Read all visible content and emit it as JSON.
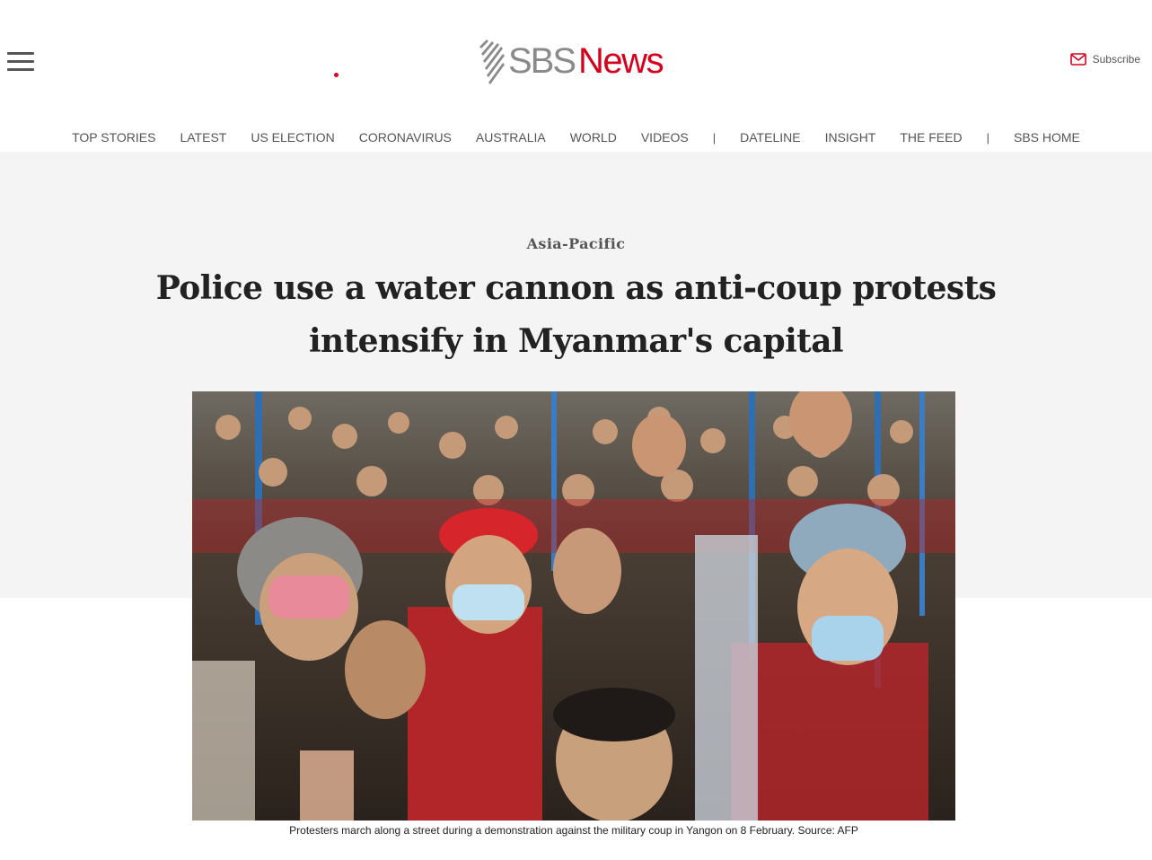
{
  "header": {
    "logo_primary": "SBS",
    "logo_secondary": "News",
    "subscribe_label": "Subscribe",
    "brand_red": "#d6001c",
    "brand_grey": "#8a8a8a"
  },
  "nav": {
    "items": [
      {
        "label": "TOP STORIES"
      },
      {
        "label": "LATEST"
      },
      {
        "label": "US ELECTION"
      },
      {
        "label": "CORONAVIRUS"
      },
      {
        "label": "AUSTRALIA"
      },
      {
        "label": "WORLD"
      },
      {
        "label": "VIDEOS"
      },
      {
        "separator": "|"
      },
      {
        "label": "DATELINE"
      },
      {
        "label": "INSIGHT"
      },
      {
        "label": "THE FEED"
      },
      {
        "separator": "|"
      },
      {
        "label": "SBS HOME"
      }
    ]
  },
  "article": {
    "section": "Asia-Pacific",
    "headline": "Police use a water cannon as anti-coup protests intensify in Myanmar's capital",
    "image": {
      "description_icon": "photo-protesters",
      "caption": "Protesters march along a street during a demonstration against the military coup in Yangon on 8 February. Source: AFP"
    }
  }
}
